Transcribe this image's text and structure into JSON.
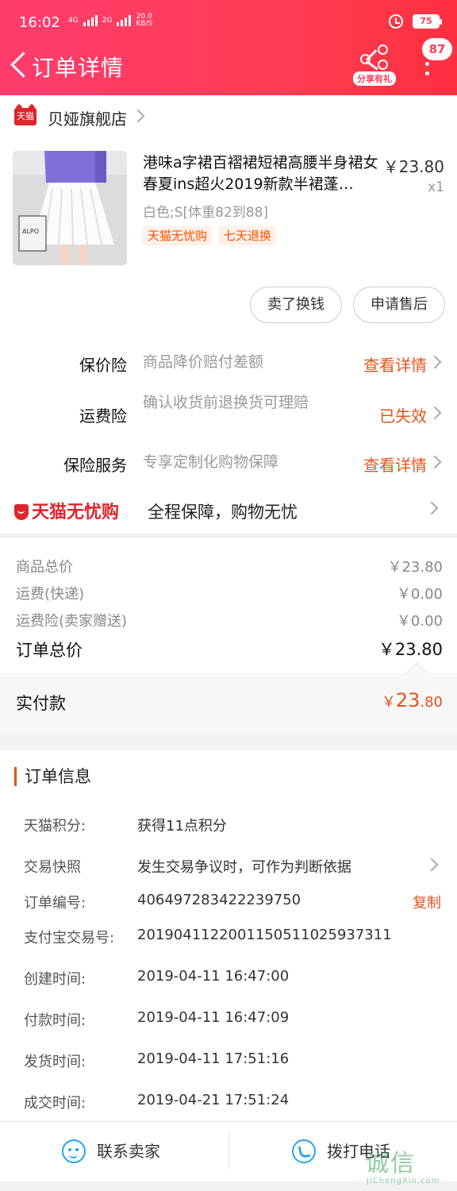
{
  "status_bar": {
    "time": "16:02",
    "net_4g": "4G",
    "net_2g": "2G",
    "speed_value": "20.0",
    "speed_unit": "KB/S",
    "battery": "75"
  },
  "header": {
    "title": "订单详情",
    "share_label": "分享有礼",
    "message_count": "87"
  },
  "store": {
    "logo_text": "天猫",
    "name": "贝娅旗舰店"
  },
  "product": {
    "title": "港味a字裙百褶裙短裙高腰半身裙女春夏ins超火2019新款半裙蓬…",
    "price": "￥23.80",
    "quantity": "x1",
    "sku": "白色;S[体重82到88]",
    "tags": [
      "天猫无忧购",
      "七天退换"
    ],
    "photo_text": "ALPO"
  },
  "actions": {
    "sell_label": "卖了换钱",
    "after_sale_label": "申请售后"
  },
  "insurance": [
    {
      "label": "保价险",
      "desc": "商品降价赔付差额",
      "action": "查看详情"
    },
    {
      "label": "运费险",
      "desc": "确认收货前退换货可理赔",
      "action": "已失效"
    },
    {
      "label": "保险服务",
      "desc": "专享定制化购物保障",
      "action": "查看详情"
    }
  ],
  "tmall_guarantee": {
    "logo": "天猫无忧购",
    "text": "全程保障，购物无忧"
  },
  "prices": {
    "rows": [
      {
        "label": "商品总价",
        "value": "￥23.80"
      },
      {
        "label": "运费(快递)",
        "value": "￥0.00"
      },
      {
        "label": "运费险(卖家赠送)",
        "value": "￥0.00"
      }
    ],
    "total_label": "订单总价",
    "total_value": "￥23.80",
    "paid_label": "实付款",
    "paid_currency": "￥",
    "paid_integer": "23",
    "paid_decimal": ".80"
  },
  "order_info": {
    "title": "订单信息",
    "rows": [
      {
        "label": "天猫积分:",
        "value": "获得11点积分"
      },
      {
        "label": "交易快照",
        "value": "发生交易争议时，可作为判断依据"
      },
      {
        "label": "订单编号:",
        "value": "406497283422239750"
      },
      {
        "label": "支付宝交易号:",
        "value": "2019041122001150511025937311"
      },
      {
        "label": "创建时间:",
        "value": "2019-04-11 16:47:00"
      },
      {
        "label": "付款时间:",
        "value": "2019-04-11 16:47:09"
      },
      {
        "label": "发货时间:",
        "value": "2019-04-11 17:51:16"
      },
      {
        "label": "成交时间:",
        "value": "2019-04-21 17:51:24"
      }
    ],
    "copy_label": "复制"
  },
  "bottom_bar": {
    "contact_label": "联系卖家",
    "call_label": "拨打电话"
  },
  "watermark": {
    "text": "诚信",
    "url": "JiChengXin.com"
  }
}
